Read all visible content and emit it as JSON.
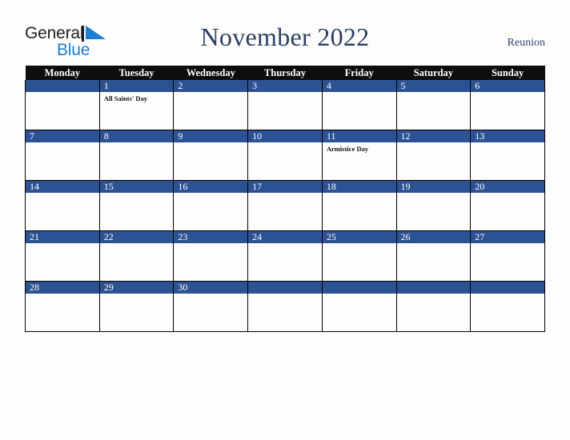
{
  "brand": {
    "name_part1": "General",
    "name_part2": "Blue",
    "mark_icon": "triangle-flag-icon",
    "color_dark": "#231f20",
    "color_blue": "#1b7fd4"
  },
  "header": {
    "title": "November 2022",
    "country": "Reunion",
    "title_color": "#2b3f63"
  },
  "calendar": {
    "header_bg": "#0d0d0d",
    "daynum_band_color": "#2d5293",
    "weekdays": [
      "Monday",
      "Tuesday",
      "Wednesday",
      "Thursday",
      "Friday",
      "Saturday",
      "Sunday"
    ],
    "weeks": [
      [
        {
          "day": "",
          "events": []
        },
        {
          "day": "1",
          "events": [
            "All Saints' Day"
          ]
        },
        {
          "day": "2",
          "events": []
        },
        {
          "day": "3",
          "events": []
        },
        {
          "day": "4",
          "events": []
        },
        {
          "day": "5",
          "events": []
        },
        {
          "day": "6",
          "events": []
        }
      ],
      [
        {
          "day": "7",
          "events": []
        },
        {
          "day": "8",
          "events": []
        },
        {
          "day": "9",
          "events": []
        },
        {
          "day": "10",
          "events": []
        },
        {
          "day": "11",
          "events": [
            "Armistice Day"
          ]
        },
        {
          "day": "12",
          "events": []
        },
        {
          "day": "13",
          "events": []
        }
      ],
      [
        {
          "day": "14",
          "events": []
        },
        {
          "day": "15",
          "events": []
        },
        {
          "day": "16",
          "events": []
        },
        {
          "day": "17",
          "events": []
        },
        {
          "day": "18",
          "events": []
        },
        {
          "day": "19",
          "events": []
        },
        {
          "day": "20",
          "events": []
        }
      ],
      [
        {
          "day": "21",
          "events": []
        },
        {
          "day": "22",
          "events": []
        },
        {
          "day": "23",
          "events": []
        },
        {
          "day": "24",
          "events": []
        },
        {
          "day": "25",
          "events": []
        },
        {
          "day": "26",
          "events": []
        },
        {
          "day": "27",
          "events": []
        }
      ],
      [
        {
          "day": "28",
          "events": []
        },
        {
          "day": "29",
          "events": []
        },
        {
          "day": "30",
          "events": []
        },
        {
          "day": "",
          "events": []
        },
        {
          "day": "",
          "events": []
        },
        {
          "day": "",
          "events": []
        },
        {
          "day": "",
          "events": []
        }
      ]
    ]
  }
}
